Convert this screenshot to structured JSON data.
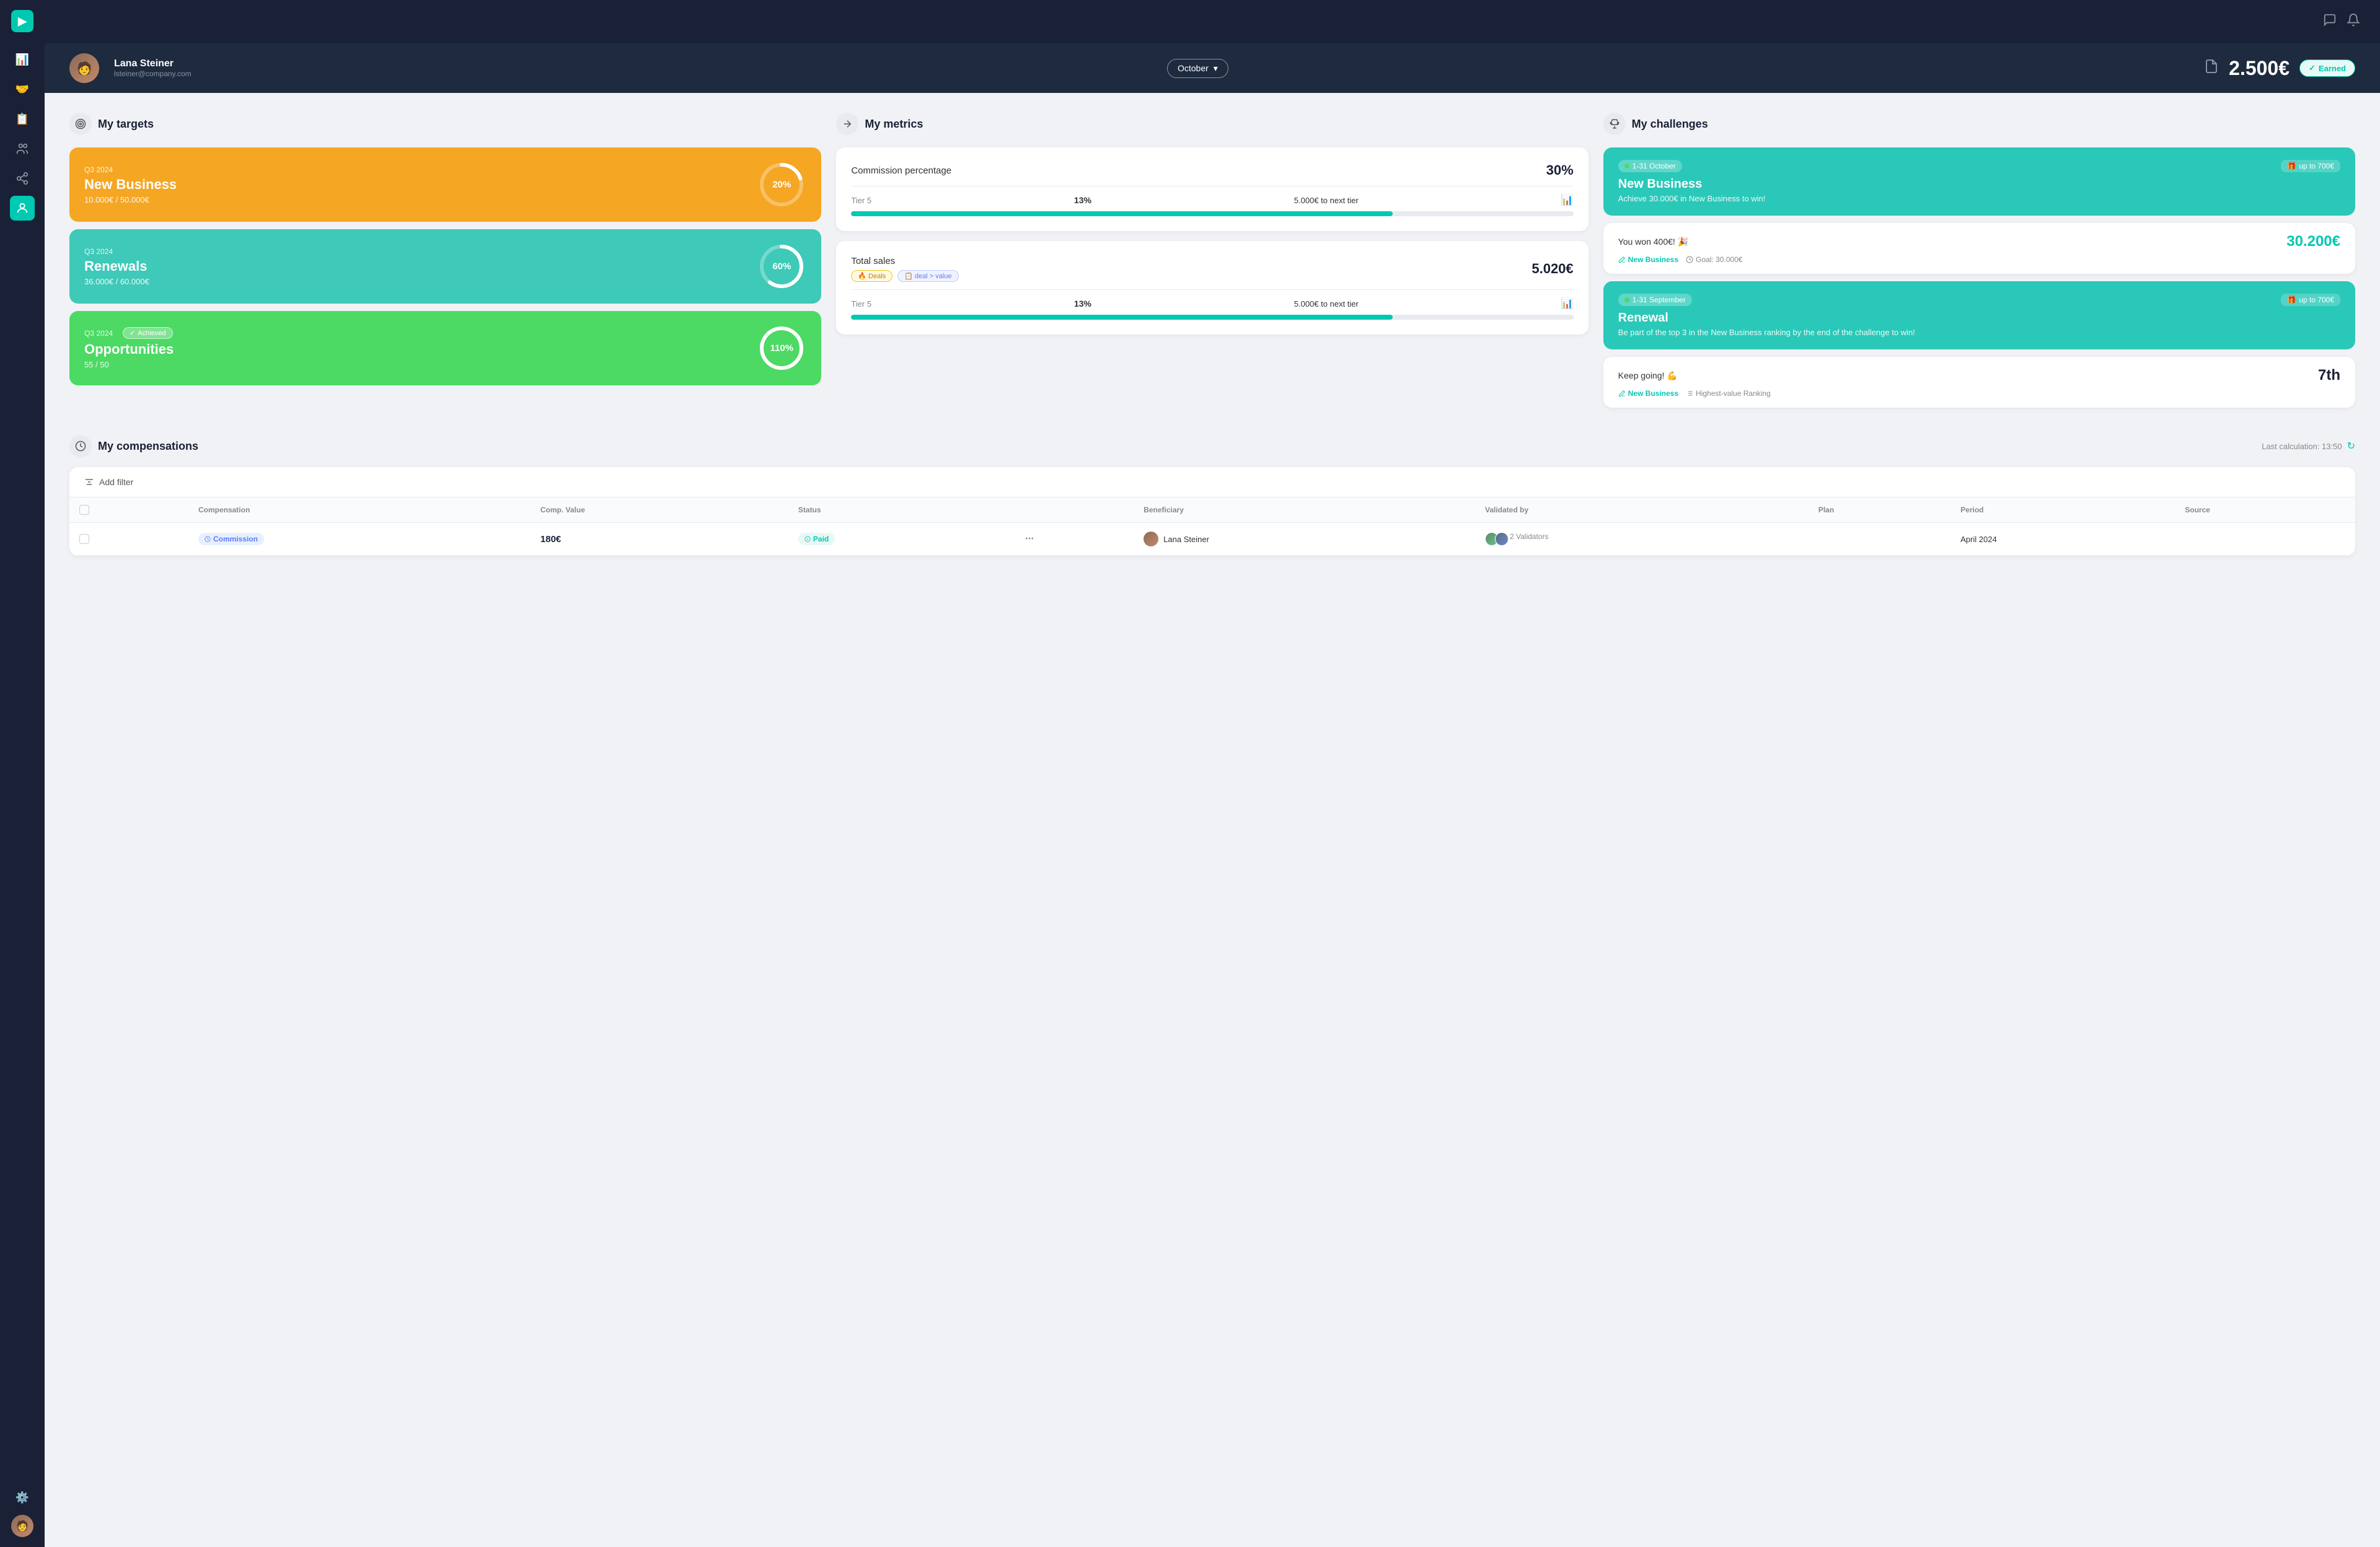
{
  "app": {
    "logo": "▶",
    "topbar": {
      "chat_icon": "💬",
      "bell_icon": "🔔"
    }
  },
  "header": {
    "user": {
      "name": "Lana Steiner",
      "email": "lsteiner@company.com"
    },
    "month_selector": {
      "label": "October",
      "icon": "▾"
    },
    "earnings": "2.500€",
    "earned_label": "Earned",
    "doc_icon": "📄"
  },
  "sidebar": {
    "nav_items": [
      {
        "icon": "📊",
        "name": "dashboard",
        "active": false
      },
      {
        "icon": "🤝",
        "name": "deals",
        "active": false
      },
      {
        "icon": "📋",
        "name": "reports",
        "active": false
      },
      {
        "icon": "👥",
        "name": "team-network",
        "active": false
      },
      {
        "icon": "🔗",
        "name": "connections",
        "active": false
      },
      {
        "icon": "👤",
        "name": "profile",
        "active": true
      }
    ],
    "bottom": {
      "settings_icon": "⚙️"
    }
  },
  "targets": {
    "section_title": "My targets",
    "cards": [
      {
        "quarter": "Q3 2024",
        "name": "New Business",
        "values": "10.000€ / 50.000€",
        "percent": "20%",
        "progress": 20,
        "color": "orange",
        "achieved": false
      },
      {
        "quarter": "Q3 2024",
        "name": "Renewals",
        "values": "36.000€ / 60.000€",
        "percent": "60%",
        "progress": 60,
        "color": "teal",
        "achieved": false
      },
      {
        "quarter": "Q3 2024",
        "name": "Opportunities",
        "values": "55 / 50",
        "percent": "110%",
        "progress": 100,
        "color": "green",
        "achieved": true,
        "achieved_label": "Achieved"
      }
    ]
  },
  "metrics": {
    "section_title": "My metrics",
    "commission": {
      "label": "Commission percentage",
      "value": "30%",
      "tier_label": "Tier 5",
      "tier_pct": "13%",
      "tier_next": "5.000€ to next tier",
      "bar_pct": 75
    },
    "total_sales": {
      "label": "Total sales",
      "value": "5.020€",
      "filter1": "Deals",
      "filter2": "deal > value",
      "tier_label": "Tier 5",
      "tier_pct": "13%",
      "tier_next": "5.000€ to next tier",
      "bar_pct": 75
    }
  },
  "challenges": {
    "section_title": "My challenges",
    "active_challenges": [
      {
        "date_range": "1-31 October",
        "prize": "up to 700€",
        "name": "New Business",
        "description": "Achieve 30.000€ in New Business to win!",
        "result_text": "You won 400€! 🎉",
        "result_amount": "30.200€",
        "tag1": "New Business",
        "tag2": "Goal: 30.000€"
      },
      {
        "date_range": "1-31 September",
        "prize": "up to 700€",
        "name": "Renewal",
        "description": "Be part of the top 3 in the New Business ranking by the end of the challenge to win!",
        "result_text": "Keep going! 💪",
        "result_rank": "7th",
        "tag1": "New Business",
        "tag2": "Highest-value Ranking"
      }
    ]
  },
  "compensations": {
    "section_title": "My compensations",
    "last_calc": "Last calculation: 13:50",
    "filter_label": "Add filter",
    "table": {
      "headers": [
        "",
        "Compensation",
        "Comp. Value",
        "Status",
        "",
        "Beneficiary",
        "Validated by",
        "Plan",
        "Period",
        "Source"
      ],
      "rows": [
        {
          "type": "Commission",
          "value": "180€",
          "status": "Paid",
          "beneficiary": "Lana Steiner",
          "validators": "2 Validators",
          "plan": "",
          "period": "April 2024",
          "source": ""
        }
      ]
    }
  }
}
